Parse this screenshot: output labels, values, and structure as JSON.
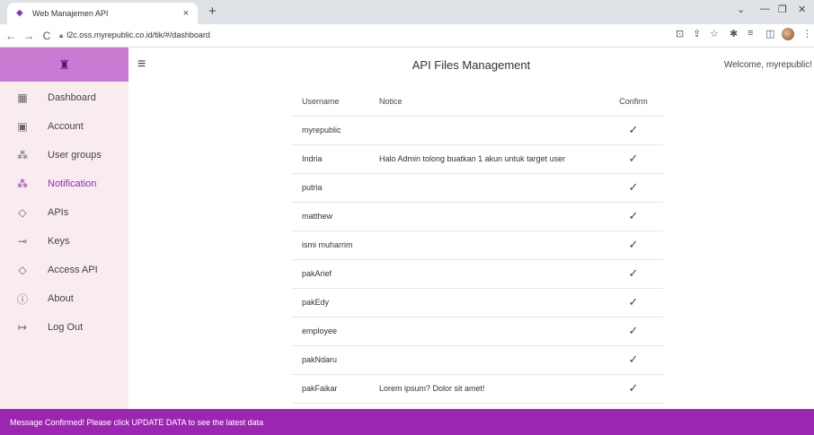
{
  "browser": {
    "tab_title": "Web Manajemen API",
    "tab_close": "×",
    "new_tab": "+",
    "url": "l2c.oss.myrepublic.co.id/tik/#/dashboard",
    "nav": {
      "back": "←",
      "forward": "→",
      "reload": "C"
    }
  },
  "app": {
    "title": "API Files Management",
    "welcome": "Welcome, myrepublic!",
    "menu_icon": "hamburger-icon"
  },
  "sidebar": {
    "items": [
      {
        "label": "Dashboard",
        "icon": "dashboard-icon",
        "glyph": "▦",
        "active": false
      },
      {
        "label": "Account",
        "icon": "account-box-icon",
        "glyph": "▣",
        "active": false
      },
      {
        "label": "User groups",
        "icon": "users-outline-icon",
        "glyph": "⁂",
        "active": false
      },
      {
        "label": "Notification",
        "icon": "people-icon",
        "glyph": "⁂",
        "active": true
      },
      {
        "label": "APIs",
        "icon": "settings-ethernet-icon",
        "glyph": "◇",
        "active": false
      },
      {
        "label": "Keys",
        "icon": "key-icon",
        "glyph": "⊸",
        "active": false
      },
      {
        "label": "Access API",
        "icon": "settings-ethernet-icon",
        "glyph": "◇",
        "active": false
      },
      {
        "label": "About",
        "icon": "info-icon",
        "glyph": "ⓘ",
        "active": false
      },
      {
        "label": "Log Out",
        "icon": "logout-icon",
        "glyph": "↦",
        "active": false
      }
    ]
  },
  "table": {
    "headers": {
      "username": "Username",
      "notice": "Notice",
      "confirm": "Confirm"
    },
    "rows": [
      {
        "username": "myrepublic",
        "notice": "",
        "confirmed": true
      },
      {
        "username": "Indria",
        "notice": "Halo Admin tolong buatkan 1 akun untuk target user",
        "confirmed": true
      },
      {
        "username": "putria",
        "notice": "",
        "confirmed": true
      },
      {
        "username": "matthew",
        "notice": "",
        "confirmed": true
      },
      {
        "username": "ismi muharrim",
        "notice": "",
        "confirmed": true
      },
      {
        "username": "pakArief",
        "notice": "",
        "confirmed": true
      },
      {
        "username": "pakEdy",
        "notice": "",
        "confirmed": true
      },
      {
        "username": "employee",
        "notice": "",
        "confirmed": true
      },
      {
        "username": "pakNdaru",
        "notice": "",
        "confirmed": true
      },
      {
        "username": "pakFaikar",
        "notice": "Lorem ipsum? Dolor sit amet!",
        "confirmed": true
      }
    ]
  },
  "snackbar": {
    "message": "Message Confirmed! Please click UPDATE DATA to see the latest data"
  },
  "colors": {
    "accent": "#9b27b0",
    "sidebar_header": "#c97ad3",
    "sidebar_bg": "#f9ecef",
    "active_nav": "#8a2fb0"
  }
}
